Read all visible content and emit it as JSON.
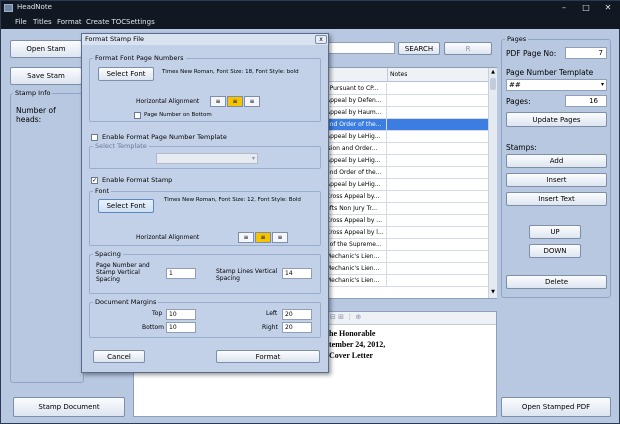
{
  "window": {
    "title": "HeadNote"
  },
  "menu": [
    "File",
    "Titles",
    "Format",
    "Create TOC",
    "Settings"
  ],
  "left": {
    "open_button": "Open Stam",
    "save_button": "Save Stam",
    "stamp_info_label": "Stamp Info",
    "number_of_heads_label": "Number of heads:",
    "stamp_document_button": "Stamp Document"
  },
  "search": {
    "button": "SEARCH",
    "extra_button": "R"
  },
  "table": {
    "notes_header": "Notes",
    "rows": [
      "l Pursuant to CP...",
      "Appeal by Defen...",
      "Appeal by Haum...",
      "and Order of the...",
      "Appeal by LeHig...",
      "ision and Order...",
      "Appeal by LeHig...",
      "and Order of the...",
      "Appeal by LeHig...",
      "Cross Appeal by...",
      "ufts Non Jury Tr...",
      "Cross Appeal by ...",
      "Cross Appeal by l...",
      "l of the Supreme...",
      "Mechanic's Lien...",
      "Mechanic's Lien...",
      "Mechanic's Lien..."
    ],
    "selected_index": 3
  },
  "preview": {
    "lines": [
      "he Honorable",
      "tember 24, 2012,",
      "Cover Letter"
    ]
  },
  "right": {
    "pages_label": "Pages",
    "pdf_page_label": "PDF Page No:",
    "pdf_page_value": "7",
    "page_number_template_label": "Page Number Template",
    "template_value": "##",
    "pages_label2": "Pages:",
    "pages_value": "16",
    "update_pages": "Update Pages",
    "stamps_label": "Stamps:",
    "add": "Add",
    "insert": "Insert",
    "insert_text": "Insert Text",
    "up": "UP",
    "down": "DOWN",
    "delete": "Delete",
    "open_stamped_pdf": "Open Stamped PDF"
  },
  "dialog": {
    "title": "Format Stamp File",
    "close": "x",
    "format_font_page_numbers": "Format Font Page Numbers",
    "select_font": "Select Font",
    "font_desc_1": "Times New Roman, Font Size: 18, Font Style: bold",
    "horizontal_alignment": "Horizontal Alignment",
    "page_number_bottom": "Page Number on Bottom",
    "enable_page_template": "Enable Format Page Number Template",
    "select_template": "Select Template",
    "enable_format_stamp": "Enable Format Stamp",
    "font_label": "Font",
    "select_font_2": "Select Font",
    "font_desc_2": "Times New Roman, Font Size: 12, Font Style: Bold",
    "horizontal_alignment_2": "Horizontal Alignment",
    "spacing_label": "Spacing",
    "page_spacing_label": "Page Number and Stamp Vertical Spacing",
    "page_spacing_value": "1",
    "stamp_lines_label": "Stamp Lines Vertical Spacing",
    "stamp_lines_value": "14",
    "margins_label": "Document Margins",
    "top_label": "Top",
    "top_value": "10",
    "left_label": "Left",
    "left_value": "20",
    "bottom_label": "Bottom",
    "bottom_value": "10",
    "right_label": "Right",
    "right_value": "20",
    "cancel": "Cancel",
    "format": "Format"
  },
  "colors": {
    "accent_selected": "#3b7de0",
    "align_active": "#f5c400"
  }
}
